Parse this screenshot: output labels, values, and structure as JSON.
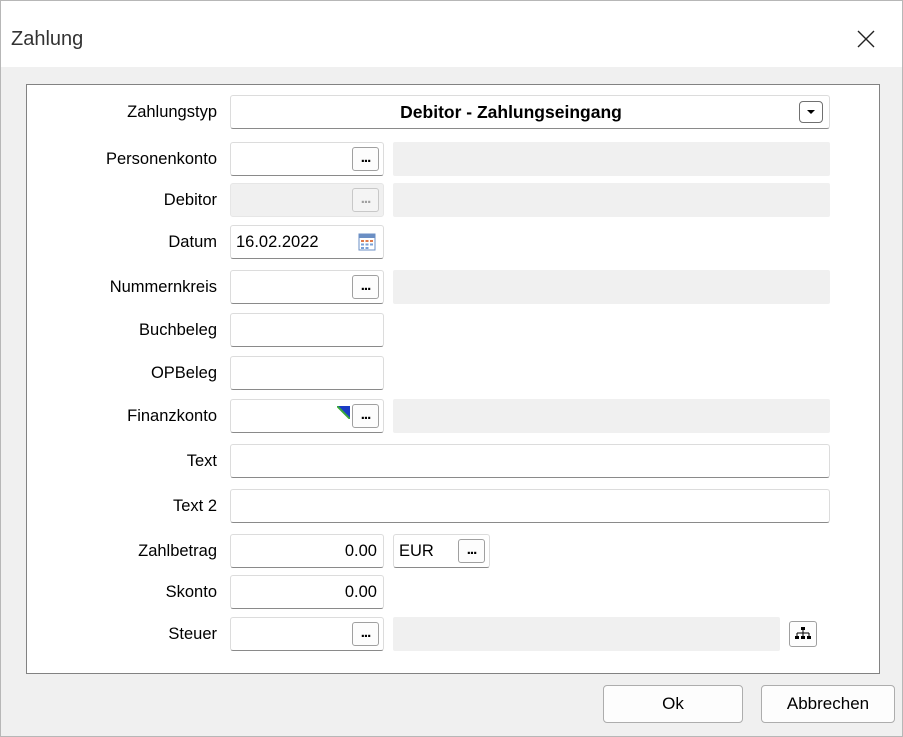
{
  "window": {
    "title": "Zahlung"
  },
  "form": {
    "zahlungstyp": {
      "label": "Zahlungstyp",
      "value": "Debitor - Zahlungseingang"
    },
    "personenkonto": {
      "label": "Personenkonto",
      "value": "",
      "button": "..."
    },
    "debitor": {
      "label": "Debitor",
      "value": "",
      "button": "..."
    },
    "datum": {
      "label": "Datum",
      "value": "16.02.2022"
    },
    "nummernkreis": {
      "label": "Nummernkreis",
      "value": "",
      "button": "..."
    },
    "buchbeleg": {
      "label": "Buchbeleg",
      "value": ""
    },
    "opbeleg": {
      "label": "OPBeleg",
      "value": ""
    },
    "finanzkonto": {
      "label": "Finanzkonto",
      "value": "",
      "button": "..."
    },
    "text": {
      "label": "Text",
      "value": ""
    },
    "text2": {
      "label": "Text 2",
      "value": ""
    },
    "zahlbetrag": {
      "label": "Zahlbetrag",
      "value": "0.00",
      "currency": "EUR",
      "button": "..."
    },
    "skonto": {
      "label": "Skonto",
      "value": "0.00"
    },
    "steuer": {
      "label": "Steuer",
      "value": "",
      "button": "..."
    }
  },
  "buttons": {
    "ok": "Ok",
    "cancel": "Abbrechen"
  },
  "icons": {
    "close": "close-icon",
    "dropdown": "chevron-down-icon",
    "calendar": "calendar-icon",
    "tree": "hierarchy-icon"
  }
}
